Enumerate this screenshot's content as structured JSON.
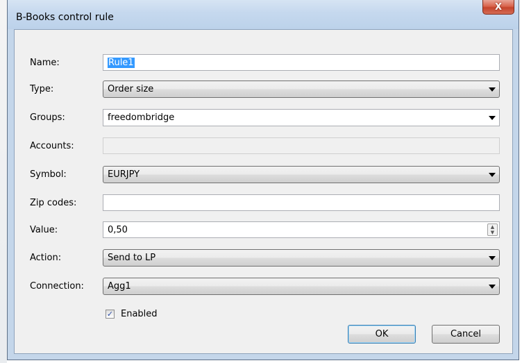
{
  "window": {
    "title": "B-Books control rule",
    "close_glyph": "X"
  },
  "form": {
    "name": {
      "label": "Name:",
      "value": "Rule1"
    },
    "type": {
      "label": "Type:",
      "value": "Order size"
    },
    "groups": {
      "label": "Groups:",
      "value": "freedombridge"
    },
    "accounts": {
      "label": "Accounts:",
      "value": ""
    },
    "symbol": {
      "label": "Symbol:",
      "value": "EURJPY"
    },
    "zip_codes": {
      "label": "Zip codes:",
      "value": ""
    },
    "value": {
      "label": "Value:",
      "value": "0,50"
    },
    "action": {
      "label": "Action:",
      "value": "Send to LP"
    },
    "connection": {
      "label": "Connection:",
      "value": "Agg1"
    },
    "enabled": {
      "label": "Enabled",
      "checked": true,
      "check_glyph": "✓"
    }
  },
  "buttons": {
    "ok": "OK",
    "cancel": "Cancel"
  },
  "icons": {
    "close": "close-icon",
    "dropdown": "chevron-down-icon",
    "spinner": "spinner-icon"
  }
}
